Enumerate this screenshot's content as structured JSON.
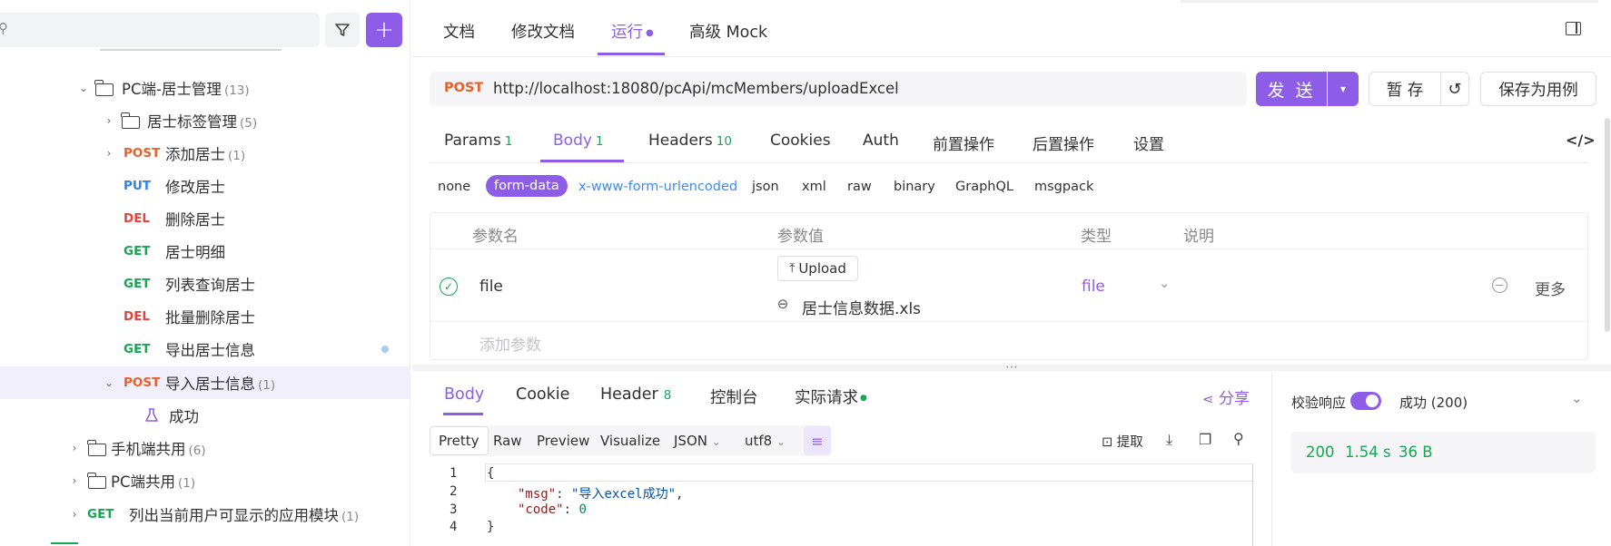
{
  "sidebar": {
    "search_placeholder": "",
    "rows": [
      {
        "type": "folder",
        "label": "PC端-居士管理",
        "count": "(13)"
      },
      {
        "type": "folder",
        "label": "居士标签管理",
        "count": "(5)"
      },
      {
        "type": "api",
        "method": "POST",
        "label": "添加居士",
        "count": "(1)"
      },
      {
        "type": "api",
        "method": "PUT",
        "label": "修改居士",
        "count": ""
      },
      {
        "type": "api",
        "method": "DEL",
        "label": "删除居士",
        "count": ""
      },
      {
        "type": "api",
        "method": "GET",
        "label": "居士明细",
        "count": ""
      },
      {
        "type": "api",
        "method": "GET",
        "label": "列表查询居士",
        "count": ""
      },
      {
        "type": "api",
        "method": "DEL",
        "label": "批量删除居士",
        "count": ""
      },
      {
        "type": "api",
        "method": "GET",
        "label": "导出居士信息",
        "count": ""
      },
      {
        "type": "api",
        "method": "POST",
        "label": "导入居士信息",
        "count": "(1)"
      },
      {
        "type": "case",
        "label": "成功"
      },
      {
        "type": "folder",
        "label": "手机端共用",
        "count": "(6)"
      },
      {
        "type": "folder",
        "label": "PC端共用",
        "count": "(1)"
      },
      {
        "type": "api",
        "method": "GET",
        "label": "列出当前用户可显示的应用模块",
        "count": "(1)"
      }
    ]
  },
  "top_tabs": [
    "文档",
    "修改文档",
    "运行",
    "高级 Mock"
  ],
  "request": {
    "method": "POST",
    "url": "http://localhost:18080/pcApi/mcMembers/uploadExcel",
    "send_label": "发 送",
    "save_temp_label": "暂 存",
    "save_case_label": "保存为用例"
  },
  "req_tabs": [
    {
      "label": "Params",
      "badge": "1"
    },
    {
      "label": "Body",
      "badge": "1"
    },
    {
      "label": "Headers",
      "badge": "10"
    },
    {
      "label": "Cookies",
      "badge": ""
    },
    {
      "label": "Auth",
      "badge": ""
    },
    {
      "label": "前置操作",
      "badge": ""
    },
    {
      "label": "后置操作",
      "badge": ""
    },
    {
      "label": "设置",
      "badge": ""
    }
  ],
  "body_types": [
    "none",
    "form-data",
    "x-www-form-urlencoded",
    "json",
    "xml",
    "raw",
    "binary",
    "GraphQL",
    "msgpack"
  ],
  "param_headers": {
    "name": "参数名",
    "value": "参数值",
    "type": "类型",
    "desc": "说明"
  },
  "param_row": {
    "name": "file",
    "upload_label": "Upload",
    "file_name": "居士信息数据.xls",
    "type": "file",
    "more": "更多"
  },
  "add_param_placeholder": "添加参数",
  "resp_tabs": [
    {
      "label": "Body",
      "badge": ""
    },
    {
      "label": "Cookie",
      "badge": ""
    },
    {
      "label": "Header",
      "badge": "8"
    },
    {
      "label": "控制台",
      "badge": ""
    },
    {
      "label": "实际请求",
      "badge": ""
    }
  ],
  "share_label": "分享",
  "formats": [
    "Pretty",
    "Raw",
    "Preview",
    "Visualize",
    "JSON",
    "utf8"
  ],
  "extract_label": "提取",
  "code_lines": [
    "1",
    "2",
    "3",
    "4"
  ],
  "code": {
    "msg_key": "\"msg\"",
    "msg_val": "\"导入excel成功\"",
    "code_key": "\"code\"",
    "code_val": "0"
  },
  "validate_label": "校验响应",
  "validate_result": "成功 (200)",
  "stats": {
    "status": "200",
    "time": "1.54 s",
    "size": "36 B"
  },
  "colors": {
    "accent": "#8d5de8",
    "post": "#e6612b",
    "put": "#2e82f5",
    "del": "#e8413c",
    "get": "#14a853"
  }
}
